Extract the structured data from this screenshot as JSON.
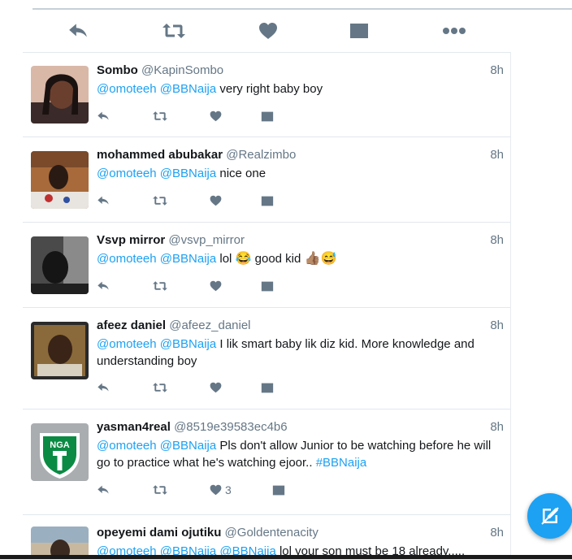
{
  "main_actions": [
    "reply-icon",
    "retweet-icon",
    "like-icon",
    "message-icon",
    "more-icon"
  ],
  "tweets": [
    {
      "name": "Sombo",
      "handle": "@KapinSombo",
      "time": "8h",
      "mention1": "@omoteeh",
      "mention2": "@BBNaija",
      "body": " very right baby boy",
      "like_count": ""
    },
    {
      "name": "mohammed abubakar",
      "handle": "@Realzimbo",
      "time": "8h",
      "mention1": "@omoteeh",
      "mention2": "@BBNaija",
      "body": " nice one",
      "like_count": ""
    },
    {
      "name": "Vsvp mirror",
      "handle": "@vsvp_mirror",
      "time": "8h",
      "mention1": "@omoteeh",
      "mention2": "@BBNaija",
      "body": " lol ",
      "emoji1": "😂",
      "body2": " good kid ",
      "emoji2": "👍🏽",
      "emoji3": "😅",
      "like_count": ""
    },
    {
      "name": "afeez daniel",
      "handle": "@afeez_daniel",
      "time": "8h",
      "mention1": "@omoteeh",
      "mention2": "@BBNaija",
      "body": "  I lik smart baby lik diz kid. More knowledge and understanding boy",
      "like_count": ""
    },
    {
      "name": "yasman4real",
      "handle": "@8519e39583ec4b6",
      "time": "8h",
      "mention1": "@omoteeh",
      "mention2": "@BBNaija",
      "body": " Pls don't allow Junior to be watching before he will go to practice what he's watching ejoor.. ",
      "hashtag": "#BBNaija",
      "avatar_text": "NGA",
      "like_count": "3"
    },
    {
      "name": "opeyemi dami ojutiku",
      "handle": "@Goldentenacity",
      "time": "8h",
      "mention1": "@omoteeh",
      "mention2": "@BBNaija",
      "mention3": "@BBNaija",
      "body": "  lol your son must be 18 already.....",
      "like_count": ""
    }
  ],
  "compose_icon": "compose-icon",
  "colors": {
    "link": "#1da1f2",
    "muted": "#657786",
    "divider": "#e1e8ed",
    "fab": "#1da1f2"
  }
}
